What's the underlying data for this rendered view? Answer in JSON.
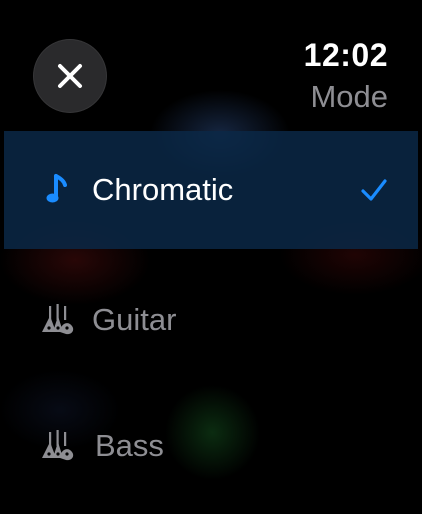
{
  "status": {
    "time": "12:02"
  },
  "header": {
    "title": "Mode",
    "close_icon": "close-icon"
  },
  "colors": {
    "accent": "#1a8cff",
    "selected_row_bg": "#0a2846",
    "muted_text": "#8e8e93"
  },
  "modes": [
    {
      "label": "Chromatic",
      "icon": "music-note-icon",
      "selected": true
    },
    {
      "label": "Guitar",
      "icon": "guitar-icon",
      "selected": false
    },
    {
      "label": "Bass",
      "icon": "bass-icon",
      "selected": false
    }
  ]
}
